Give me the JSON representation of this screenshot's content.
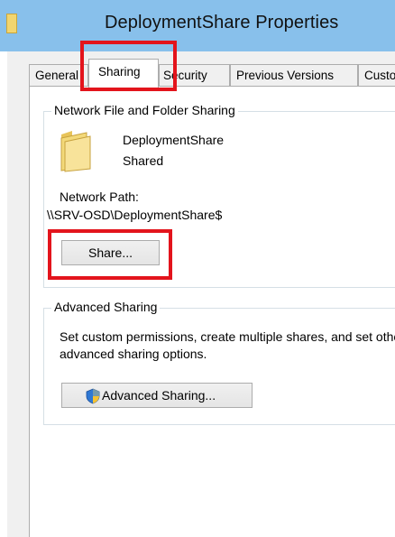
{
  "window": {
    "title": "DeploymentShare Properties"
  },
  "tabs": [
    {
      "label": "General",
      "active": false
    },
    {
      "label": "Sharing",
      "active": true
    },
    {
      "label": "Security",
      "active": false
    },
    {
      "label": "Previous Versions",
      "active": false
    },
    {
      "label": "Customize",
      "active": false
    }
  ],
  "network_sharing": {
    "group_label": "Network File and Folder Sharing",
    "folder_name": "DeploymentShare",
    "status": "Shared",
    "path_label": "Network Path:",
    "path_value": "\\\\SRV-OSD\\DeploymentShare$",
    "share_button": "Share..."
  },
  "advanced_sharing": {
    "group_label": "Advanced Sharing",
    "description_line1": "Set custom permissions, create multiple shares, and set other",
    "description_line2": "advanced sharing options.",
    "button_label": "Advanced Sharing..."
  },
  "colors": {
    "highlight": "#e3141c",
    "titlebar": "#88c0eb"
  }
}
